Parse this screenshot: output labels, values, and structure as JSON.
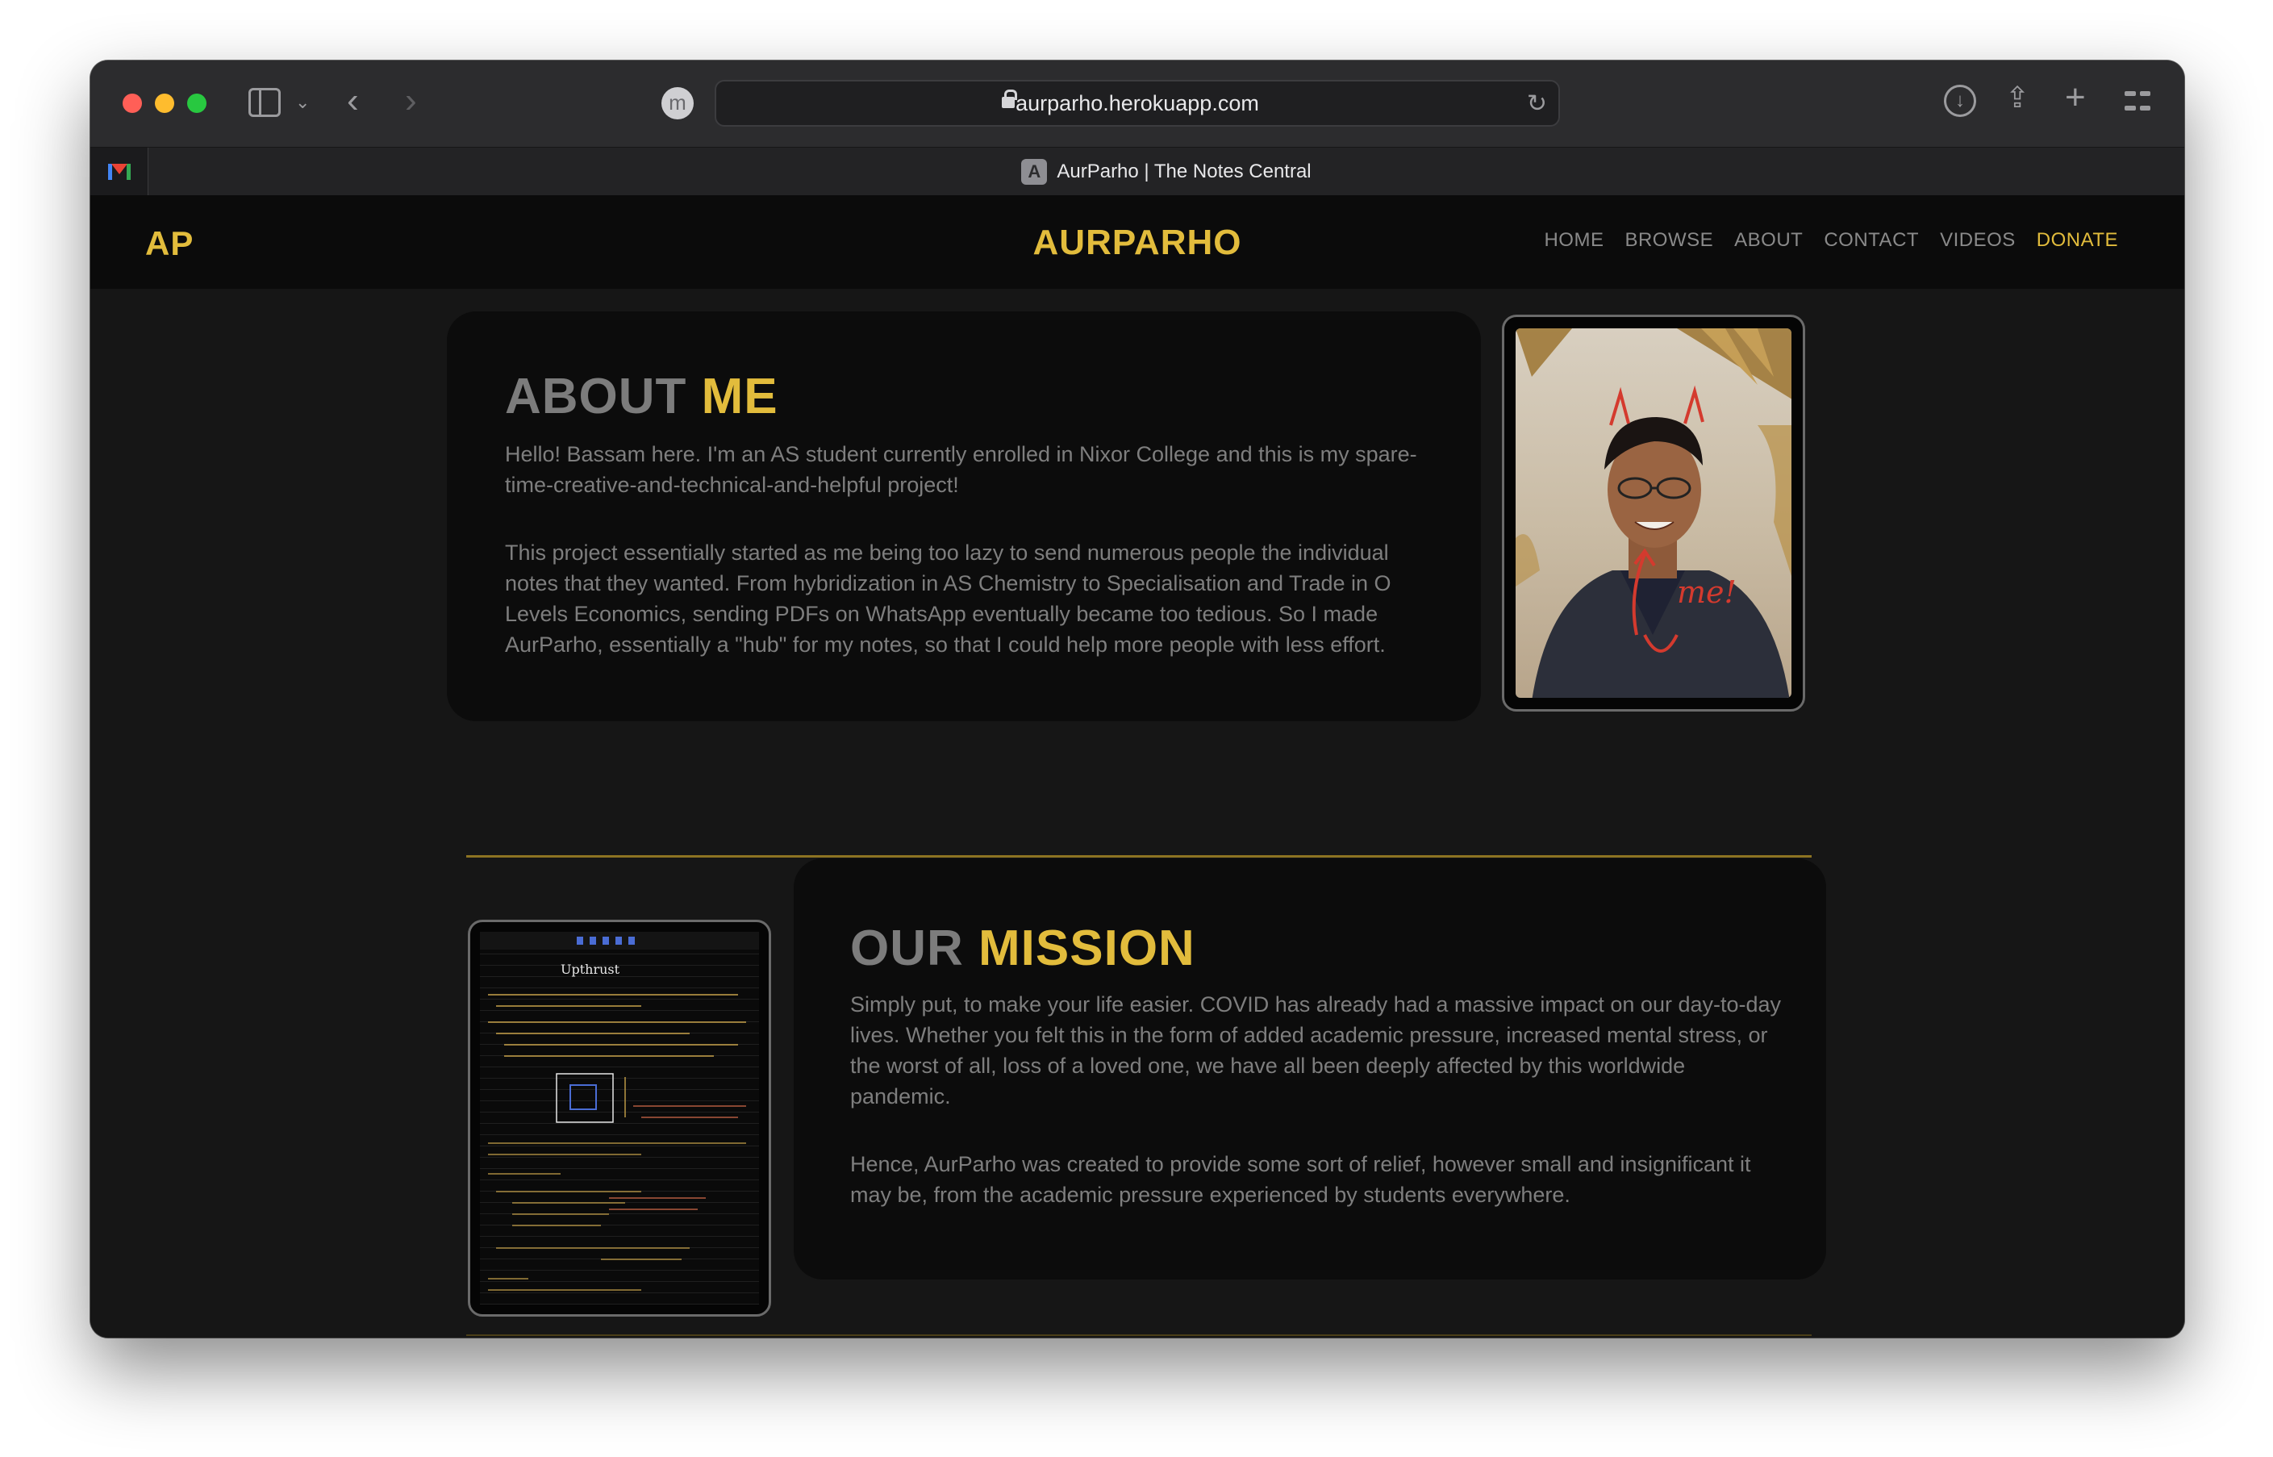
{
  "browser": {
    "url": "aurparho.herokuapp.com",
    "profile_initial": "m",
    "tab_title": "AurParho | The Notes Central",
    "tab_favicon_letter": "A"
  },
  "site": {
    "logo": "AP",
    "brand": "AURPARHO",
    "nav": [
      "HOME",
      "BROWSE",
      "ABOUT",
      "CONTACT",
      "VIDEOS",
      "DONATE"
    ],
    "accent_color": "#e2bc3c"
  },
  "about": {
    "title_plain": "ABOUT",
    "title_highlight": "ME",
    "p1": "Hello! Bassam here. I'm an AS student currently enrolled in Nixor College and this is my spare-time-creative-and-technical-and-helpful project!",
    "p2": "This project essentially started as me being too lazy to send numerous people the individual notes that they wanted. From hybridization in AS Chemistry to Specialisation and Trade in O Levels Economics, sending PDFs on WhatsApp eventually became too tedious. So I made AurParho, essentially a \"hub\" for my notes, so that I could help more people with less effort.",
    "photo_annotation": "me!"
  },
  "mission": {
    "title_plain": "OUR",
    "title_highlight": "MISSION",
    "p1": "Simply put, to make your life easier. COVID has already had a massive impact on our day-to-day lives. Whether you felt this in the form of added academic pressure, increased mental stress, or the worst of all, loss of a loved one, we have all been deeply affected by this worldwide pandemic.",
    "p2": "Hence, AurParho was created to provide some sort of relief, however small and insignificant it may be, from the academic pressure experienced by students everywhere.",
    "notes_heading": "Upthrust"
  }
}
